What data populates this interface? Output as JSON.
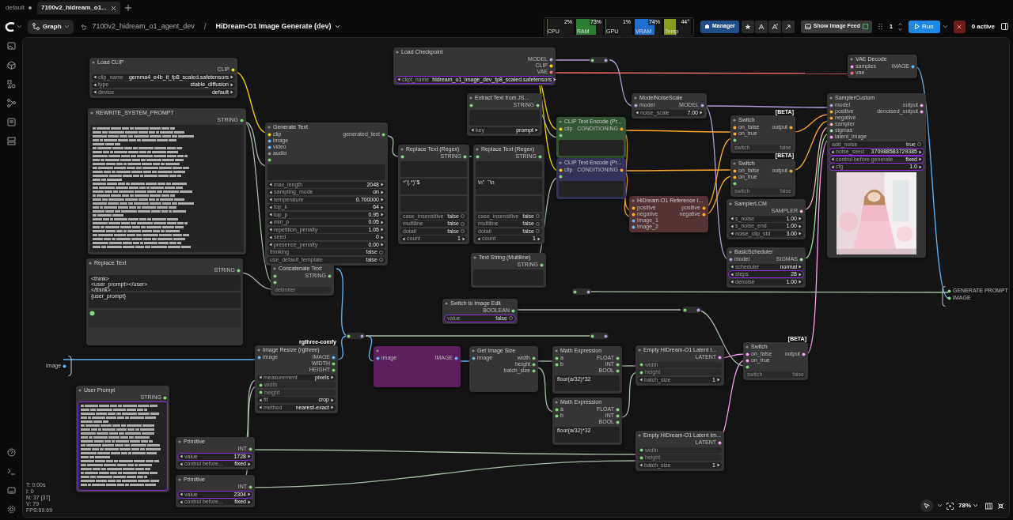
{
  "tabs": [
    {
      "label": "default",
      "selected": false
    },
    {
      "label": "7100v2_hidream_o1...",
      "selected": true
    }
  ],
  "toolbar": {
    "graph_button": "Graph",
    "workflow": "7100v2_hidream_o1_agent_dev",
    "separator": "/",
    "subgraph": "HiDream-O1 Image Generate (dev)"
  },
  "monitor": [
    {
      "label": "CPU",
      "reading": "2%",
      "level": 0.02,
      "color": "#2e7d32"
    },
    {
      "label": "RAM",
      "reading": "73%",
      "level": 0.73,
      "color": "#2e7d32"
    },
    {
      "label": "GPU",
      "reading": "1%",
      "level": 0.01,
      "color": "#2e7d32"
    },
    {
      "label": "VRAM",
      "reading": "74%",
      "level": 0.74,
      "color": "#1e6fd0"
    },
    {
      "label": "Temp",
      "reading": "44°",
      "level": 0.44,
      "color": "#8a9a1a"
    }
  ],
  "actions": {
    "manager": "Manager",
    "image_feed": "Show Image Feed",
    "queue_count": "1",
    "run": "Run",
    "active": "0 active"
  },
  "nodes": [
    {
      "title": "Load CLIP",
      "color": "#353535",
      "outputs": [
        {
          "label": "CLIP",
          "color": "#ffd500"
        }
      ],
      "widgets": [
        {
          "kind": "combo",
          "name": "clip_name",
          "value": "gemma4_e4b_it_fp8_scaled.safetensors",
          "selected": false
        },
        {
          "kind": "combo",
          "name": "type",
          "value": "stable_diffusion",
          "selected": false
        },
        {
          "kind": "combo",
          "name": "device",
          "value": "default",
          "selected": false
        }
      ]
    },
    {
      "title": "REWRITE_SYSTEM_PROMPT",
      "color": "#353535",
      "outputs": [
        {
          "label": "STRING",
          "color": "#7fd67f"
        }
      ],
      "widgets": [
        {
          "kind": "textlines",
          "selected": false
        }
      ]
    },
    {
      "title": "Replace Text",
      "color": "#353535",
      "outputs": [
        {
          "label": "STRING",
          "color": "#7fd67f"
        }
      ],
      "widgets": [
        {
          "kind": "textarea",
          "value": "<think>\n<user_prompt></user>\n</think>",
          "selected": false
        },
        {
          "kind": "textarea",
          "value": "{user_prompt}",
          "selected": false
        },
        {
          "kind": "inputarea",
          "color": "#7fd67f"
        }
      ]
    },
    {
      "title": "Generate Text",
      "color": "#353535",
      "inputs": [
        {
          "label": "clip",
          "color": "#ffd500"
        },
        {
          "label": "image",
          "color": "#64b5f6"
        },
        {
          "label": "video",
          "color": "#64b5f6"
        },
        {
          "label": "audio",
          "color": "#888888"
        },
        {
          "color": "#7fd67f"
        }
      ],
      "outputs": [
        {
          "label": "generated_text",
          "color": "#7fd67f"
        }
      ],
      "widgets": [
        {
          "kind": "textarea",
          "selected": false
        },
        {
          "kind": "combo",
          "name": "max_length",
          "value": "2048",
          "selected": false
        },
        {
          "kind": "combo",
          "name": "sampling_mode",
          "value": "on",
          "selected": false
        },
        {
          "kind": "combo",
          "name": "temperature",
          "value": "0.700000",
          "selected": false
        },
        {
          "kind": "combo",
          "name": "top_k",
          "value": "64",
          "selected": false
        },
        {
          "kind": "combo",
          "name": "top_p",
          "value": "0.95",
          "selected": false
        },
        {
          "kind": "combo",
          "name": "min_p",
          "value": "0.05",
          "selected": false
        },
        {
          "kind": "combo",
          "name": "repetition_penalty",
          "value": "1.05",
          "selected": false
        },
        {
          "kind": "combo",
          "name": "seed",
          "value": "0",
          "selected": false
        },
        {
          "kind": "combo",
          "name": "presence_penalty",
          "value": "0.00",
          "selected": false
        },
        {
          "kind": "toggle",
          "name": "thinking",
          "value": "false",
          "selected": false
        },
        {
          "kind": "toggle",
          "name": "use_default_template",
          "value": "false",
          "selected": false
        }
      ]
    },
    {
      "title": "Concatenate Text",
      "color": "#353535",
      "inputs": [
        {
          "color": "#7fd67f"
        },
        {
          "color": "#7fd67f"
        }
      ],
      "outputs": [
        {
          "label": "STRING",
          "color": "#7fd67f"
        }
      ],
      "widgets": [
        {
          "kind": "slot",
          "name": "delimiter",
          "selected": false
        }
      ]
    },
    {
      "title": "Load Checkpoint",
      "color": "#353535",
      "outputs": [
        {
          "label": "MODEL",
          "color": "#b39ddb"
        },
        {
          "label": "CLIP",
          "color": "#ffd500"
        },
        {
          "label": "VAE",
          "color": "#ff6e6e"
        }
      ],
      "widgets": [
        {
          "kind": "combo",
          "name": "ckpt_name",
          "value": "hidream_o1_image_dev_fp8_scaled.safetensors",
          "selected": true
        }
      ]
    },
    {
      "title": "Extract Text from JS...",
      "color": "#353535",
      "inputs": [
        {
          "color": "#7fd67f"
        }
      ],
      "outputs": [
        {
          "label": "STRING",
          "color": "#7fd67f"
        }
      ],
      "widgets": [
        {
          "kind": "textarea",
          "selected": false
        },
        {
          "kind": "combo",
          "name": "key",
          "value": "prompt",
          "selected": false
        }
      ]
    },
    {
      "title": "Replace Text (Regex)",
      "color": "#353535",
      "inputs": [
        {
          "color": "#7fd67f"
        }
      ],
      "outputs": [
        {
          "label": "STRING",
          "color": "#7fd67f"
        }
      ],
      "widgets": [
        {
          "kind": "textarea",
          "selected": false
        },
        {
          "kind": "textarea",
          "value": "^\"(.*)\"$",
          "selected": false
        },
        {
          "kind": "textarea",
          "selected": false
        },
        {
          "kind": "toggle",
          "name": "case_insensitive",
          "value": "false",
          "selected": false
        },
        {
          "kind": "toggle",
          "name": "multiline",
          "value": "false",
          "selected": false
        },
        {
          "kind": "toggle",
          "name": "dotall",
          "value": "false",
          "selected": false
        },
        {
          "kind": "combo",
          "name": "count",
          "value": "1",
          "selected": false
        }
      ]
    },
    {
      "title": "Replace Text (Regex)",
      "color": "#353535",
      "inputs": [
        {
          "color": "#7fd67f"
        }
      ],
      "outputs": [
        {
          "label": "STRING",
          "color": "#7fd67f"
        }
      ],
      "widgets": [
        {
          "kind": "textarea",
          "selected": false
        },
        {
          "kind": "textarea",
          "value": "\\n\"  \"\\n",
          "selected": false
        },
        {
          "kind": "textarea",
          "selected": false
        },
        {
          "kind": "toggle",
          "name": "case_insensitive",
          "value": "false",
          "selected": false
        },
        {
          "kind": "toggle",
          "name": "multiline",
          "value": "false",
          "selected": false
        },
        {
          "kind": "toggle",
          "name": "dotall",
          "value": "false",
          "selected": false
        },
        {
          "kind": "combo",
          "name": "count",
          "value": "1",
          "selected": false
        }
      ]
    },
    {
      "title": "Text String (Multiline)",
      "color": "#353535",
      "outputs": [
        {
          "label": "STRING",
          "color": "#7fd67f"
        }
      ],
      "widgets": [
        {
          "kind": "textarea",
          "selected": false
        }
      ]
    },
    {
      "title": "CLIP Text Encode (Pr...",
      "color": "#335533",
      "inputs": [
        {
          "label": "clip",
          "color": "#ffd500"
        },
        {
          "color": "#7fd67f"
        }
      ],
      "outputs": [
        {
          "label": "CONDITIONING",
          "color": "#ffa931"
        }
      ],
      "widgets": [
        {
          "kind": "textarea",
          "selected": false
        }
      ]
    },
    {
      "title": "CLIP Text Encode (Pr...",
      "color": "#33335a",
      "inputs": [
        {
          "label": "clip",
          "color": "#ffd500"
        },
        {
          "color": "#7fd67f"
        }
      ],
      "outputs": [
        {
          "label": "CONDITIONING",
          "color": "#ffa931"
        }
      ],
      "widgets": [
        {
          "kind": "textarea",
          "selected": false
        }
      ]
    },
    {
      "title": "ModelNoiseScale",
      "color": "#353535",
      "inputs": [
        {
          "label": "model",
          "color": "#b39ddb"
        }
      ],
      "outputs": [
        {
          "label": "MODEL",
          "color": "#b39ddb"
        }
      ],
      "widgets": [
        {
          "kind": "combo",
          "name": "noise_scale",
          "value": "7.00",
          "selected": false
        }
      ]
    },
    {
      "title": "HiDream-O1 Reference I...",
      "color": "#553333",
      "inputs": [
        {
          "label": "positive",
          "color": "#ffa931"
        },
        {
          "label": "negative",
          "color": "#ffa931"
        },
        {
          "label": "image_1",
          "color": "#64b5f6"
        },
        {
          "label": "image_2",
          "color": "#64b5f6"
        }
      ],
      "outputs": [
        {
          "label": "positive",
          "color": "#ffa931"
        },
        {
          "label": "negative",
          "color": "#ffa931"
        }
      ]
    },
    {
      "title": "Switch",
      "badge": "[BETA]",
      "color": "#353535",
      "inputs": [
        {
          "label": "on_false",
          "color": "#ffa931"
        },
        {
          "label": "on_true",
          "color": "#ffa931"
        },
        {
          "color": "#7fd67f"
        }
      ],
      "outputs": [
        {
          "label": "output",
          "color": "#ffa931"
        }
      ],
      "widgets": [
        {
          "kind": "slot",
          "name": "switch",
          "value": "false",
          "selected": false
        }
      ]
    },
    {
      "title": "Switch",
      "badge": "[BETA]",
      "color": "#353535",
      "inputs": [
        {
          "label": "on_false",
          "color": "#ffa931"
        },
        {
          "label": "on_true",
          "color": "#ffa931"
        },
        {
          "color": "#7fd67f"
        }
      ],
      "outputs": [
        {
          "label": "output",
          "color": "#ffa931"
        }
      ],
      "widgets": [
        {
          "kind": "slot",
          "name": "switch",
          "value": "false",
          "selected": false
        }
      ]
    },
    {
      "title": "SamplerLCM",
      "color": "#353535",
      "outputs": [
        {
          "label": "SAMPLER",
          "color": "#ecb4b4"
        }
      ],
      "widgets": [
        {
          "kind": "combo",
          "name": "s_noise",
          "value": "1.00",
          "selected": false
        },
        {
          "kind": "combo",
          "name": "s_noise_end",
          "value": "1.00",
          "selected": false
        },
        {
          "kind": "combo",
          "name": "noise_clip_std",
          "value": "3.00",
          "selected": false
        }
      ]
    },
    {
      "title": "BasicScheduler",
      "color": "#353535",
      "inputs": [
        {
          "label": "model",
          "color": "#b39ddb"
        }
      ],
      "outputs": [
        {
          "label": "SIGMAS",
          "color": "#9fe09f"
        }
      ],
      "widgets": [
        {
          "kind": "combo",
          "name": "scheduler",
          "value": "normal",
          "selected": false
        },
        {
          "kind": "combo",
          "name": "steps",
          "value": "28",
          "selected": true
        },
        {
          "kind": "combo",
          "name": "denoise",
          "value": "1.00",
          "selected": false
        }
      ]
    },
    {
      "title": "VAE Decode",
      "color": "#353535",
      "inputs": [
        {
          "label": "samples",
          "color": "#ff9cf9"
        },
        {
          "label": "vae",
          "color": "#ff6e6e"
        }
      ],
      "outputs": [
        {
          "label": "IMAGE",
          "color": "#64b5f6"
        }
      ]
    },
    {
      "title": "SamplerCustom",
      "color": "#353535",
      "inputs": [
        {
          "label": "model",
          "color": "#b39ddb"
        },
        {
          "label": "positive",
          "color": "#ffa931"
        },
        {
          "label": "negative",
          "color": "#ffa931"
        },
        {
          "label": "sampler",
          "color": "#ecb4b4"
        },
        {
          "label": "sigmas",
          "color": "#9fe09f"
        },
        {
          "label": "latent_image",
          "color": "#ff9cf9"
        }
      ],
      "outputs": [
        {
          "label": "output",
          "color": "#ff9cf9"
        },
        {
          "label": "denoised_output",
          "color": "#ff9cf9"
        }
      ],
      "widgets": [
        {
          "kind": "toggle",
          "name": "add_noise",
          "value": "true",
          "selected": false
        },
        {
          "kind": "combo",
          "name": "noise_seed",
          "value": "370988583729385",
          "selected": true
        },
        {
          "kind": "combo",
          "name": "control before generate",
          "value": "fixed",
          "selected": true
        },
        {
          "kind": "combo",
          "name": "cfg",
          "value": "1.0",
          "selected": true
        },
        {
          "kind": "picture"
        }
      ]
    },
    {
      "title": "Switch to Image Edit",
      "color": "#353535",
      "outputs": [
        {
          "label": "BOOLEAN",
          "color": "#7fd67f"
        }
      ],
      "widgets": [
        {
          "kind": "toggle",
          "name": "value",
          "value": "false",
          "selected": true
        }
      ]
    },
    {
      "title": "User Prompt",
      "color": "#353535",
      "outputs": [
        {
          "label": "STRING",
          "color": "#7fd67f"
        }
      ],
      "widgets": [
        {
          "kind": "textlines",
          "selected": true
        }
      ]
    },
    {
      "title": "Image Resize (rgthree)",
      "badge": "rgthree-comfy",
      "color": "#353535",
      "inputs": [
        {
          "label": "image",
          "color": "#64b5f6"
        }
      ],
      "outputs": [
        {
          "label": "IMAGE",
          "color": "#64b5f6"
        },
        {
          "label": "WIDTH",
          "color": "#7fd67f"
        },
        {
          "label": "HEIGHT",
          "color": "#7fd67f"
        }
      ],
      "widgets": [
        {
          "kind": "combo",
          "name": "measurement",
          "value": "pixels",
          "selected": false
        },
        {
          "kind": "slot",
          "name": "width",
          "color": "#7fd67f",
          "selected": false
        },
        {
          "kind": "slot",
          "name": "height",
          "color": "#7fd67f",
          "selected": false
        },
        {
          "kind": "combo",
          "name": "fit",
          "value": "crop",
          "selected": false
        },
        {
          "kind": "combo",
          "name": "method",
          "value": "nearest-exact",
          "selected": false
        }
      ]
    },
    {
      "color": "#5e1f5e",
      "inputs": [
        {
          "label": "image",
          "color": "#64b5f6"
        }
      ],
      "outputs": [
        {
          "label": "IMAGE",
          "color": "#64b5f6"
        }
      ]
    },
    {
      "title": "Get Image Size",
      "color": "#353535",
      "inputs": [
        {
          "label": "image",
          "color": "#64b5f6"
        }
      ],
      "outputs": [
        {
          "label": "width",
          "color": "#7fd67f"
        },
        {
          "label": "height",
          "color": "#7fd67f"
        },
        {
          "label": "batch_size",
          "color": "#7fd67f"
        }
      ]
    },
    {
      "title": "Math Expression",
      "color": "#353535",
      "inputs": [
        {
          "label": "a",
          "color": "#7fd67f"
        },
        {
          "label": "b",
          "color": "#7fd67f"
        }
      ],
      "outputs": [
        {
          "label": "FLOAT",
          "color": "#7fd67f"
        },
        {
          "label": "INT",
          "color": "#7fd67f"
        },
        {
          "label": "BOOL",
          "color": "#7fd67f"
        }
      ],
      "widgets": [
        {
          "kind": "textarea",
          "value": "floor(a/32)*32",
          "selected": false
        }
      ]
    },
    {
      "title": "Empty HiDream-O1 Latent I...",
      "color": "#353535",
      "outputs": [
        {
          "label": "LATENT",
          "color": "#ff9cf9"
        }
      ],
      "widgets": [
        {
          "kind": "slot",
          "name": "width",
          "color": "#7fd67f",
          "selected": false
        },
        {
          "kind": "slot",
          "name": "height",
          "color": "#7fd67f",
          "selected": false
        },
        {
          "kind": "combo",
          "name": "batch_size",
          "value": "1",
          "selected": false
        }
      ]
    },
    {
      "title": "Switch",
      "badge": "[BETA]",
      "color": "#353535",
      "inputs": [
        {
          "label": "on_false",
          "color": "#ff9cf9"
        },
        {
          "label": "on_true",
          "color": "#ff9cf9"
        },
        {
          "color": "#7fd67f"
        }
      ],
      "outputs": [
        {
          "label": "output",
          "color": "#ff9cf9"
        }
      ],
      "widgets": [
        {
          "kind": "slot",
          "name": "switch",
          "value": "false",
          "selected": false
        }
      ]
    },
    {
      "title": "Primitive",
      "color": "#353535",
      "outputs": [
        {
          "label": "INT",
          "color": "#7fd67f"
        }
      ],
      "widgets": [
        {
          "kind": "combo",
          "name": "value",
          "value": "1728",
          "selected": true
        },
        {
          "kind": "combo",
          "name": "control before...",
          "value": "fixed",
          "selected": false
        }
      ]
    },
    {
      "title": "Primitive",
      "color": "#353535",
      "outputs": [
        {
          "label": "INT",
          "color": "#7fd67f"
        }
      ],
      "widgets": [
        {
          "kind": "combo",
          "name": "value",
          "value": "2304",
          "selected": true
        },
        {
          "kind": "combo",
          "name": "control before...",
          "value": "fixed",
          "selected": false
        }
      ]
    },
    {
      "title": "Math Expression",
      "color": "#353535",
      "inputs": [
        {
          "label": "a",
          "color": "#7fd67f"
        },
        {
          "label": "b",
          "color": "#7fd67f"
        }
      ],
      "outputs": [
        {
          "label": "FLOAT",
          "color": "#7fd67f"
        },
        {
          "label": "INT",
          "color": "#7fd67f"
        },
        {
          "label": "BOOL",
          "color": "#7fd67f"
        }
      ],
      "widgets": [
        {
          "kind": "textarea",
          "value": "floor(a/32)*32",
          "selected": false
        }
      ]
    },
    {
      "title": "Empty HiDream-O1 Latent Im...",
      "color": "#353535",
      "outputs": [
        {
          "label": "LATENT",
          "color": "#ff9cf9"
        }
      ],
      "widgets": [
        {
          "kind": "slot",
          "name": "width",
          "color": "#7fd67f",
          "selected": false
        },
        {
          "kind": "slot",
          "name": "height",
          "color": "#7fd67f",
          "selected": false
        },
        {
          "kind": "combo",
          "name": "batch_size",
          "value": "1",
          "selected": false
        }
      ]
    }
  ],
  "graph_inputs": [
    {
      "label": "image"
    }
  ],
  "graph_outputs": [
    {
      "label": "GENERATE PROMPT"
    },
    {
      "label": "IMAGE"
    }
  ],
  "stats": [
    "T: 0.00s",
    "I: 0",
    "N: 37 [37]",
    "V: 79",
    "FPS:69.69"
  ],
  "zoom": "78%"
}
